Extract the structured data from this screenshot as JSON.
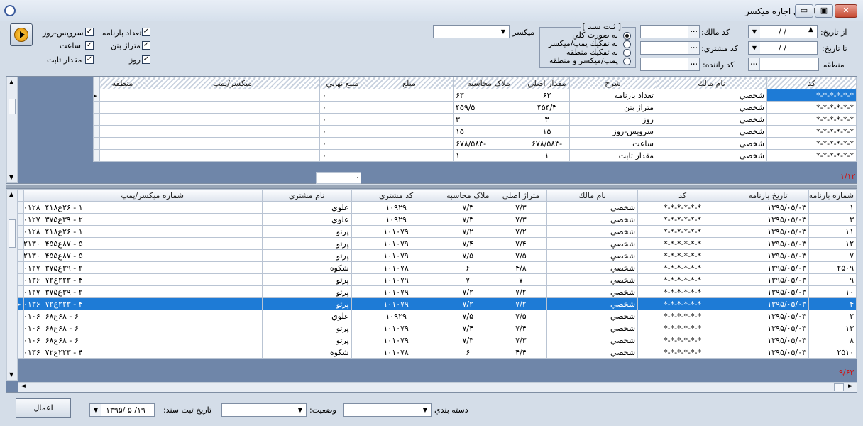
{
  "window": {
    "title": "حسابداري اجاره ميكسر",
    "close": "✕",
    "max": "▣",
    "min": "▭"
  },
  "filters": {
    "from_date_label": "از تاريخ:",
    "from_date": "/   /",
    "to_date_label": "تا تاريخ:",
    "to_date": "/   /",
    "region_label": "منطقه",
    "owner_code_label": "كد مالك:",
    "customer_code_label": "كد مشتري:",
    "driver_code_label": "كد راننده:",
    "mixer_label": "ميكسر",
    "dots": "...",
    "dd": "▼"
  },
  "voucher": {
    "title": "[ ثبت سند ]",
    "options": [
      "به صورت كلي",
      "به تفكيك پمپ/ميكسر",
      "به تفكيك منطقه",
      "پمپ/ميكسر و منطقه"
    ],
    "selected": 0
  },
  "checks": {
    "col1": [
      "تعداد بارنامه",
      "متراژ بتن",
      "روز"
    ],
    "col2": [
      "سرويس-روز",
      "ساعت",
      "مقدار ثابت"
    ],
    "mark": "✓"
  },
  "grid1": {
    "headers": [
      "كد",
      "نام مالك",
      "شرح",
      "مقدار اصلي",
      "ملاک محاسبه",
      "مبلغ",
      "مبلغ نهايي",
      "ميكسر/پمپ",
      "منطقه"
    ],
    "rows": [
      [
        "*-*-*-*-*-*",
        "شخصي",
        "تعداد بارنامه",
        "۶۳",
        "۶۳",
        "",
        "۰",
        "",
        ""
      ],
      [
        "*-*-*-*-*-*",
        "شخصي",
        "متراژ بتن",
        "۴۵۴/۳",
        "۴۵۹/۵",
        "",
        "۰",
        "",
        ""
      ],
      [
        "*-*-*-*-*-*",
        "شخصي",
        "روز",
        "۳",
        "۳",
        "",
        "۰",
        "",
        ""
      ],
      [
        "*-*-*-*-*-*",
        "شخصي",
        "سرويس-روز",
        "۱۵",
        "۱۵",
        "",
        "۰",
        "",
        ""
      ],
      [
        "*-*-*-*-*-*",
        "شخصي",
        "ساعت",
        "-۶۷۸/۵۸۳",
        "-۶۷۸/۵۸۳",
        "",
        "۰",
        "",
        ""
      ],
      [
        "*-*-*-*-*-*",
        "شخصي",
        "مقدار ثابت",
        "۱",
        "۱",
        "",
        "۰",
        "",
        ""
      ]
    ],
    "total": "۰",
    "count": "۱/۱۲"
  },
  "grid2": {
    "headers": [
      "شماره بارنامه",
      "تاريخ بارنامه",
      "كد",
      "نام مالك",
      "متراژ اصلي",
      "ملاک محاسبه",
      "كد مشتري",
      "نام مشتري",
      "شماره ميكسر/پمپ"
    ],
    "rows": [
      [
        "۱",
        "۱۳۹۵/۰۵/۰۳",
        "*-*-*-*-*-*",
        "شخصي",
        "۷/۳",
        "۷/۳",
        "۱۰۹۲۹",
        "علوي",
        "۱ - ۲۶ع۴۱۸",
        "۰۱۲۸"
      ],
      [
        "۳",
        "۱۳۹۵/۰۵/۰۳",
        "*-*-*-*-*-*",
        "شخصي",
        "۷/۳",
        "۷/۳",
        "۱۰۹۲۹",
        "علوي",
        "۲ - ۳۹ع۳۷۵",
        "۰۱۲۷"
      ],
      [
        "۱۱",
        "۱۳۹۵/۰۵/۰۳",
        "*-*-*-*-*-*",
        "شخصي",
        "۷/۲",
        "۷/۲",
        "۱۰۱۰۷۹",
        "پرتو",
        "۱ - ۲۶ع۴۱۸",
        "۰۱۲۸"
      ],
      [
        "۱۲",
        "۱۳۹۵/۰۵/۰۳",
        "*-*-*-*-*-*",
        "شخصي",
        "۷/۴",
        "۷/۴",
        "۱۰۱۰۷۹",
        "پرتو",
        "۵ - ۸۷ع۴۵۵",
        "۲۱۳۰"
      ],
      [
        "۷",
        "۱۳۹۵/۰۵/۰۳",
        "*-*-*-*-*-*",
        "شخصي",
        "۷/۵",
        "۷/۵",
        "۱۰۱۰۷۹",
        "پرتو",
        "۵ - ۸۷ع۴۵۵",
        "۲۱۳۰"
      ],
      [
        "۲۵۰۹",
        "۱۳۹۵/۰۵/۰۳",
        "*-*-*-*-*-*",
        "شخصي",
        "۴/۸",
        "۶",
        "۱۰۱۰۷۸",
        "شكوه",
        "۲ - ۳۹ع۳۷۵",
        "۰۱۲۷"
      ],
      [
        "۹",
        "۱۳۹۵/۰۵/۰۳",
        "*-*-*-*-*-*",
        "شخصي",
        "۷",
        "۷",
        "۱۰۱۰۷۹",
        "پرتو",
        "۴ - ۲۲۳ع۷۲",
        "۰۱۳۶"
      ],
      [
        "۱۰",
        "۱۳۹۵/۰۵/۰۳",
        "*-*-*-*-*-*",
        "شخصي",
        "۷/۲",
        "۷/۲",
        "۱۰۱۰۷۹",
        "پرتو",
        "۲ - ۳۹ع۳۷۵",
        "۰۱۲۷"
      ],
      [
        "۴",
        "۱۳۹۵/۰۵/۰۳",
        "*-*-*-*-*-*",
        "شخصي",
        "۷/۲",
        "۷/۲",
        "۱۰۱۰۷۹",
        "پرتو",
        "۴ - ۲۲۳ع۷۲",
        "۰۱۳۶"
      ],
      [
        "۲",
        "۱۳۹۵/۰۵/۰۳",
        "*-*-*-*-*-*",
        "شخصي",
        "۷/۵",
        "۷/۵",
        "۱۰۹۲۹",
        "علوي",
        "۶ - ۶۸ع۶۸",
        "۰۱۰۶"
      ],
      [
        "۱۳",
        "۱۳۹۵/۰۵/۰۳",
        "*-*-*-*-*-*",
        "شخصي",
        "۷/۴",
        "۷/۴",
        "۱۰۱۰۷۹",
        "پرتو",
        "۶ - ۶۸ع۶۸",
        "۰۱۰۶"
      ],
      [
        "۸",
        "۱۳۹۵/۰۵/۰۳",
        "*-*-*-*-*-*",
        "شخصي",
        "۷/۳",
        "۷/۳",
        "۱۰۱۰۷۹",
        "پرتو",
        "۶ - ۶۸ع۶۸",
        "۰۱۰۶"
      ],
      [
        "۲۵۱۰",
        "۱۳۹۵/۰۵/۰۳",
        "*-*-*-*-*-*",
        "شخصي",
        "۴/۴",
        "۶",
        "۱۰۱۰۷۸",
        "شكوه",
        "۴ - ۲۲۳ع۷۲",
        "۰۱۳۶"
      ]
    ],
    "selected_row": 8,
    "count": "۹/۶۳"
  },
  "footer": {
    "apply": "اعمال",
    "doc_date_label": "تاريخ ثبت سند:",
    "doc_date": "۱۳۹۵/ ۵ /۱۹",
    "status_label": "وضعيت:",
    "category_label": "دسته بندي"
  }
}
